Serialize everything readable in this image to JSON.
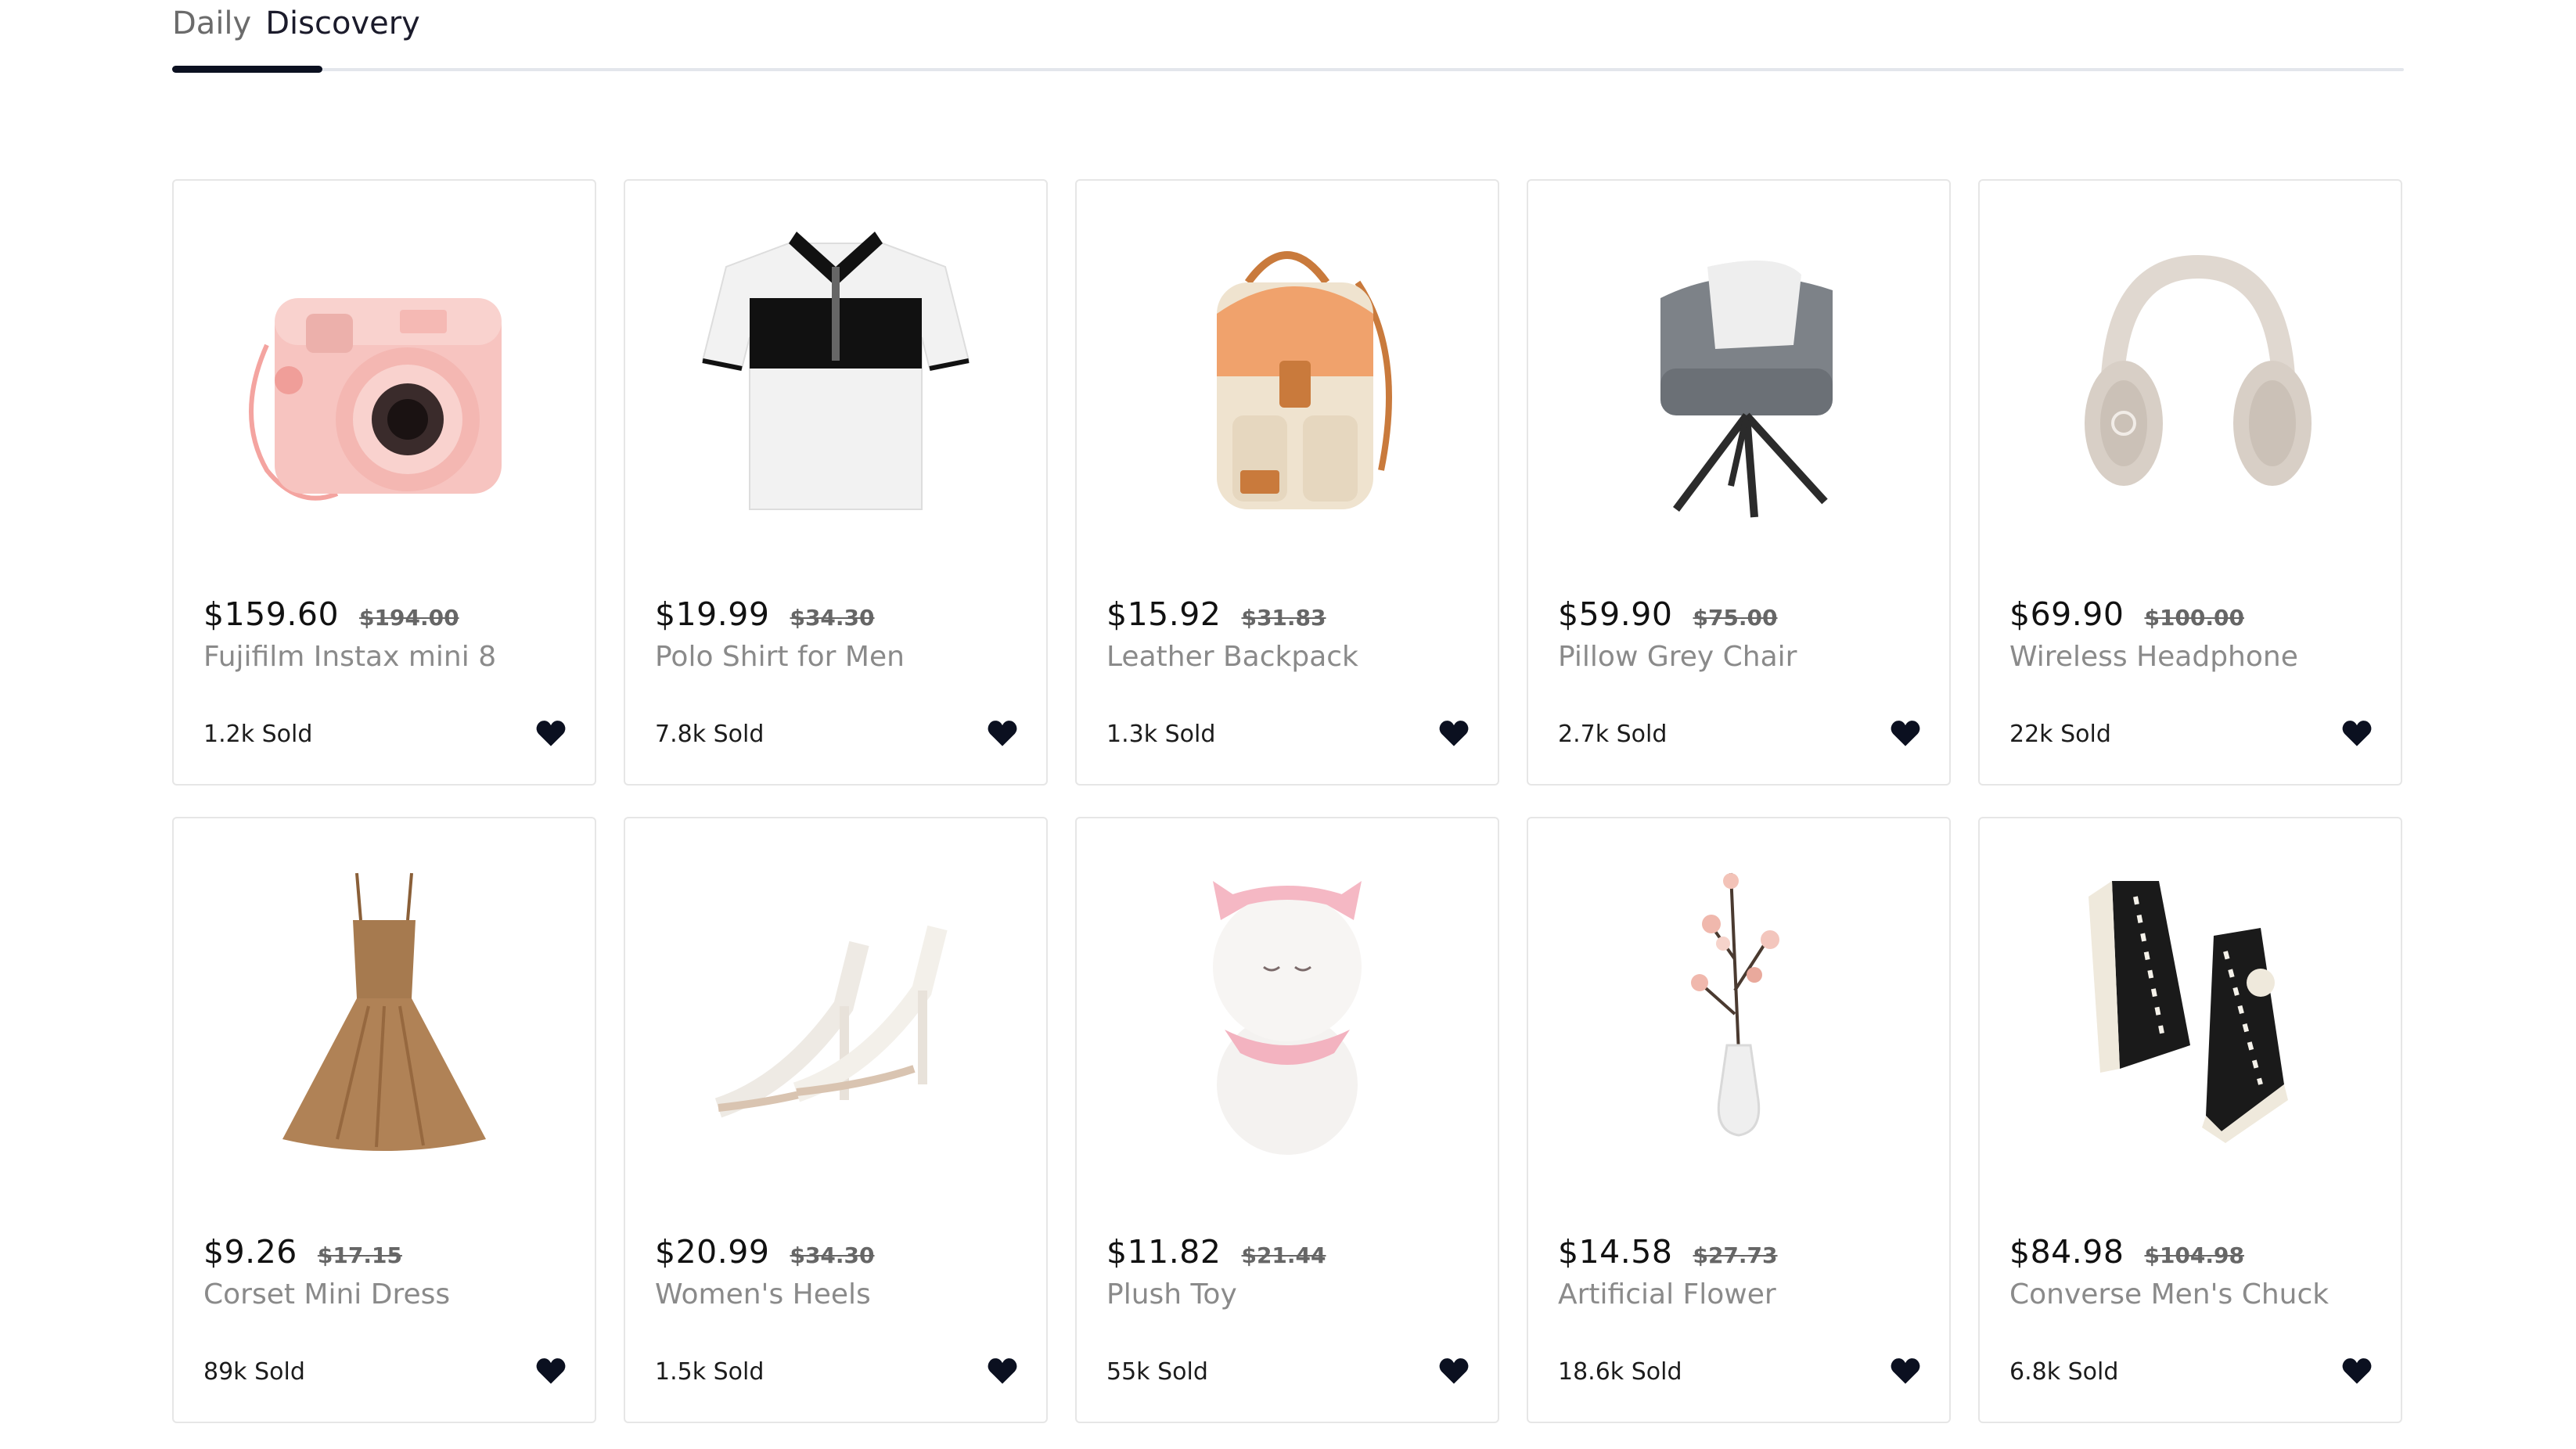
{
  "section": {
    "title_part1": "Daily",
    "title_part2": "Discovery"
  },
  "colors": {
    "accent": "#0b1020",
    "track": "#e3e6ec",
    "heart": "#0b1020",
    "card_border": "#e6e6e6"
  },
  "products": [
    {
      "price": "$159.60",
      "old_price": "$194.00",
      "name": "Fujifilm Instax mini 8",
      "sold": "1.2k Sold",
      "image_icon": "camera-image"
    },
    {
      "price": "$19.99",
      "old_price": "$34.30",
      "name": "Polo Shirt for Men",
      "sold": "7.8k Sold",
      "image_icon": "polo-shirt-image"
    },
    {
      "price": "$15.92",
      "old_price": "$31.83",
      "name": "Leather Backpack",
      "sold": "1.3k Sold",
      "image_icon": "backpack-image"
    },
    {
      "price": "$59.90",
      "old_price": "$75.00",
      "name": "Pillow Grey Chair",
      "sold": "2.7k Sold",
      "image_icon": "chair-image"
    },
    {
      "price": "$69.90",
      "old_price": "$100.00",
      "name": "Wireless Headphone",
      "sold": "22k Sold",
      "image_icon": "headphone-image"
    },
    {
      "price": "$9.26",
      "old_price": "$17.15",
      "name": "Corset Mini Dress",
      "sold": "89k Sold",
      "image_icon": "dress-image"
    },
    {
      "price": "$20.99",
      "old_price": "$34.30",
      "name": "Women's Heels",
      "sold": "1.5k Sold",
      "image_icon": "heels-image"
    },
    {
      "price": "$11.82",
      "old_price": "$21.44",
      "name": "Plush Toy",
      "sold": "55k Sold",
      "image_icon": "plush-toy-image"
    },
    {
      "price": "$14.58",
      "old_price": "$27.73",
      "name": "Artificial Flower",
      "sold": "18.6k Sold",
      "image_icon": "flower-vase-image"
    },
    {
      "price": "$84.98",
      "old_price": "$104.98",
      "name": "Converse Men's Chuck",
      "sold": "6.8k Sold",
      "image_icon": "sneakers-image"
    }
  ]
}
